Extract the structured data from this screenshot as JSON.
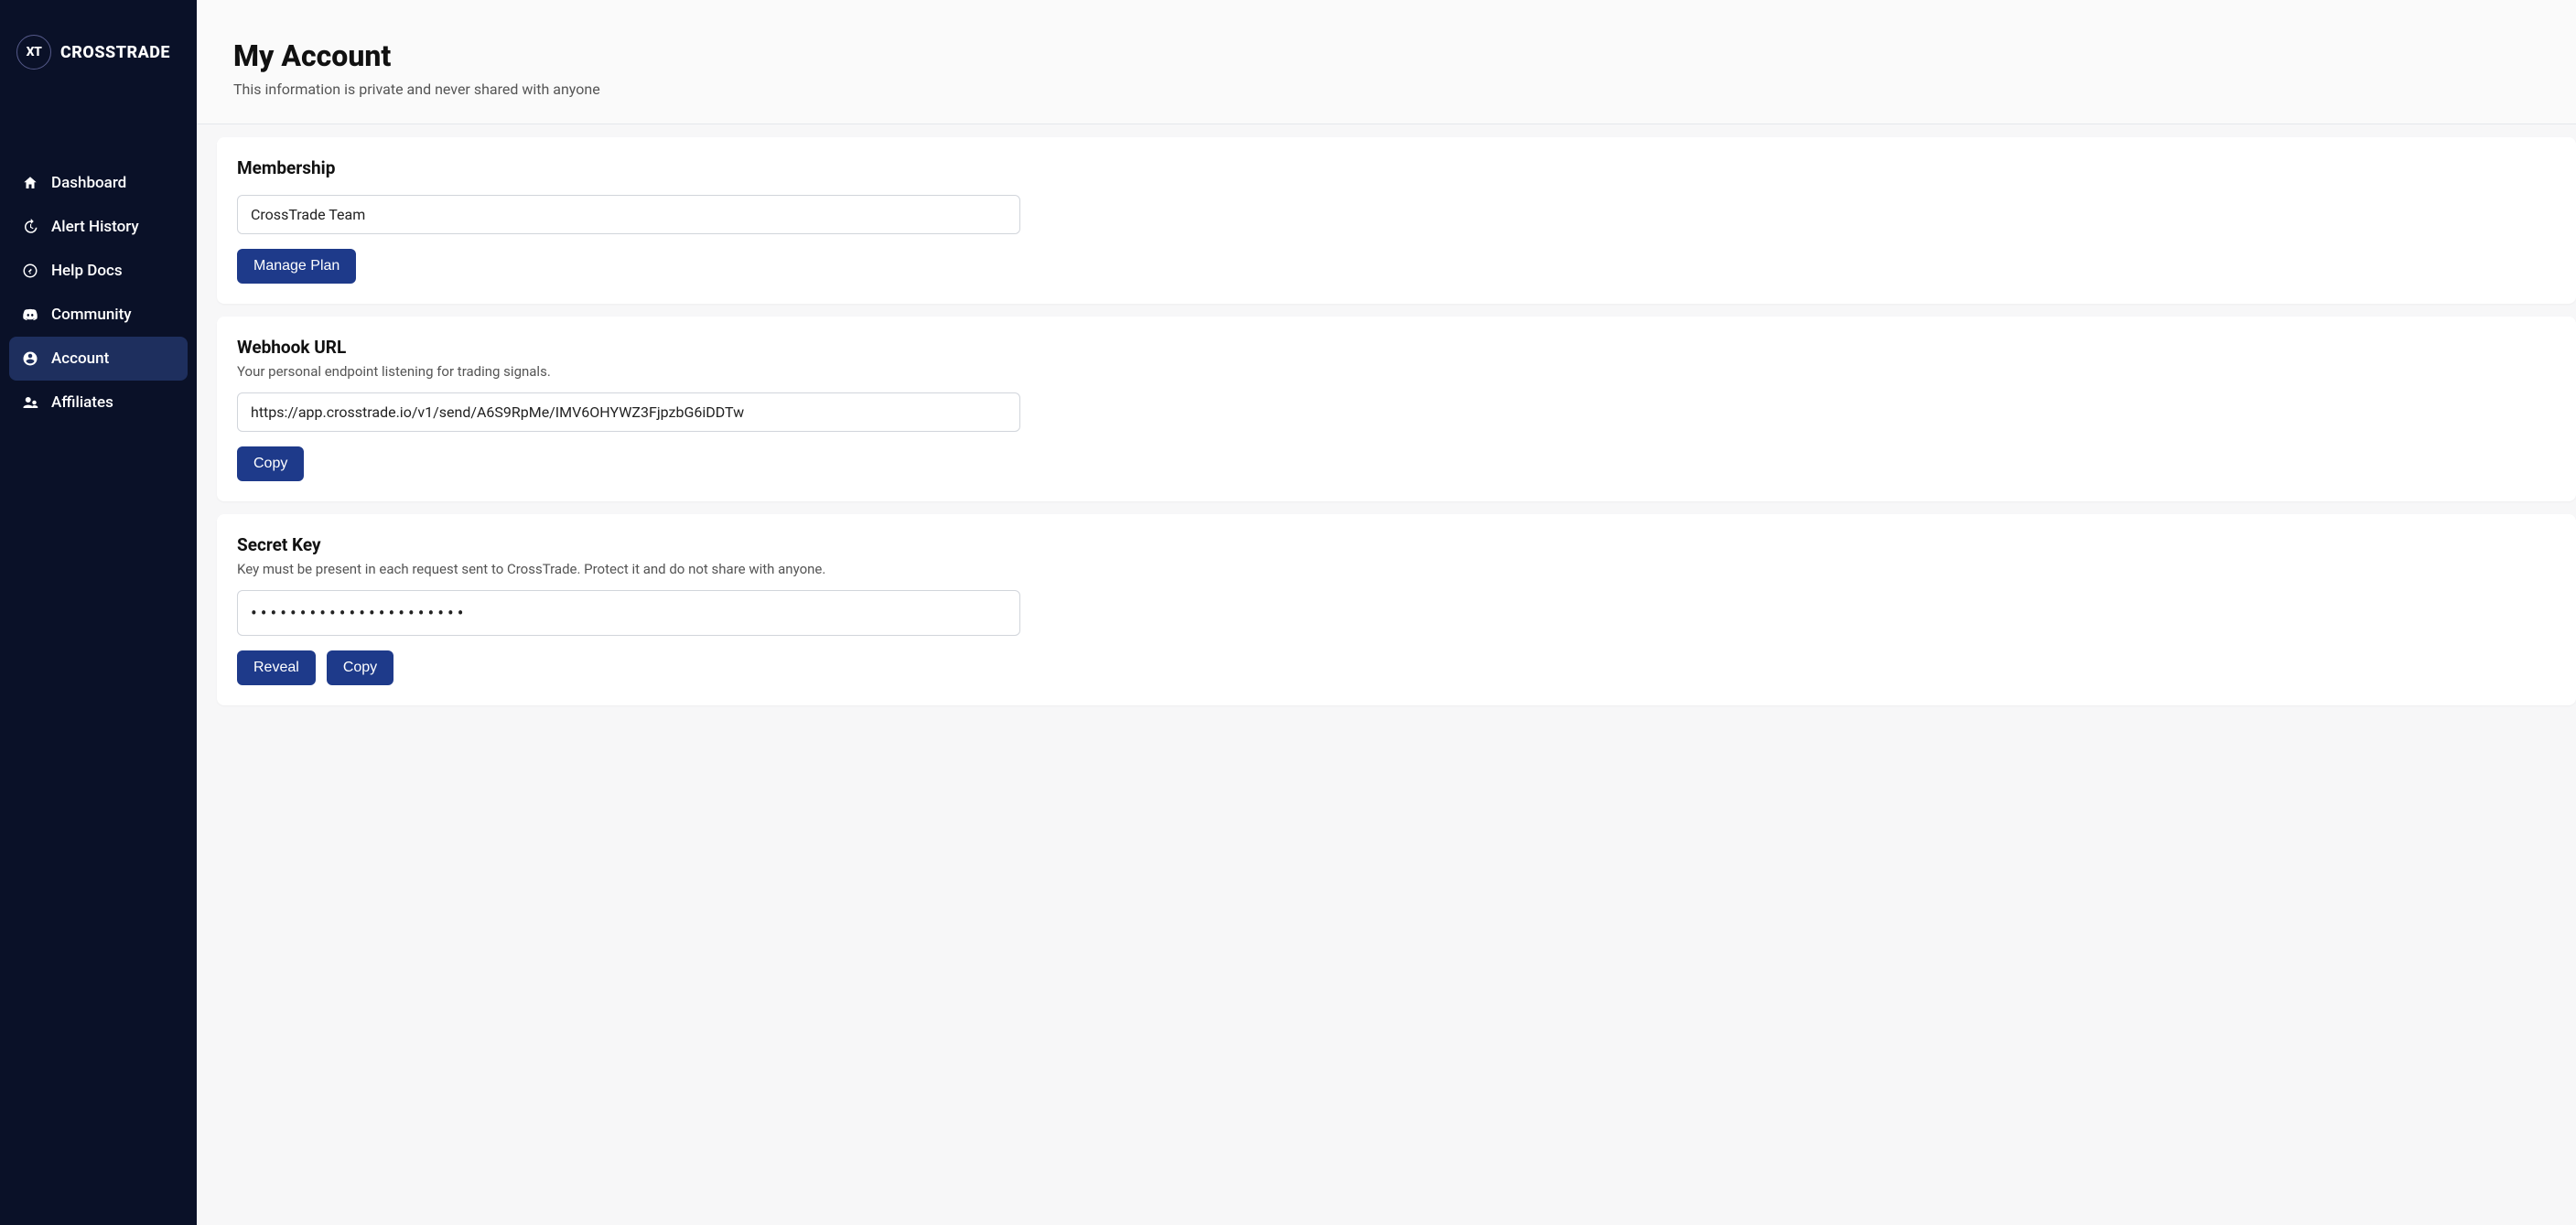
{
  "brand": {
    "short": "XT",
    "name": "CROSSTRADE"
  },
  "sidebar": {
    "items": [
      {
        "label": "Dashboard"
      },
      {
        "label": "Alert History"
      },
      {
        "label": "Help Docs"
      },
      {
        "label": "Community"
      },
      {
        "label": "Account"
      },
      {
        "label": "Affiliates"
      }
    ]
  },
  "header": {
    "title": "My Account",
    "subtitle": "This information is private and never shared with anyone"
  },
  "membership": {
    "title": "Membership",
    "value": "CrossTrade Team",
    "manage_label": "Manage Plan"
  },
  "webhook": {
    "title": "Webhook URL",
    "desc": "Your personal endpoint listening for trading signals.",
    "value": "https://app.crosstrade.io/v1/send/A6S9RpMe/IMV6OHYWZ3FjpzbG6iDDTw",
    "copy_label": "Copy"
  },
  "secret": {
    "title": "Secret Key",
    "desc": "Key must be present in each request sent to CrossTrade. Protect it and do not share with anyone.",
    "masked": "••••••••••••••••••••••",
    "reveal_label": "Reveal",
    "copy_label": "Copy"
  }
}
